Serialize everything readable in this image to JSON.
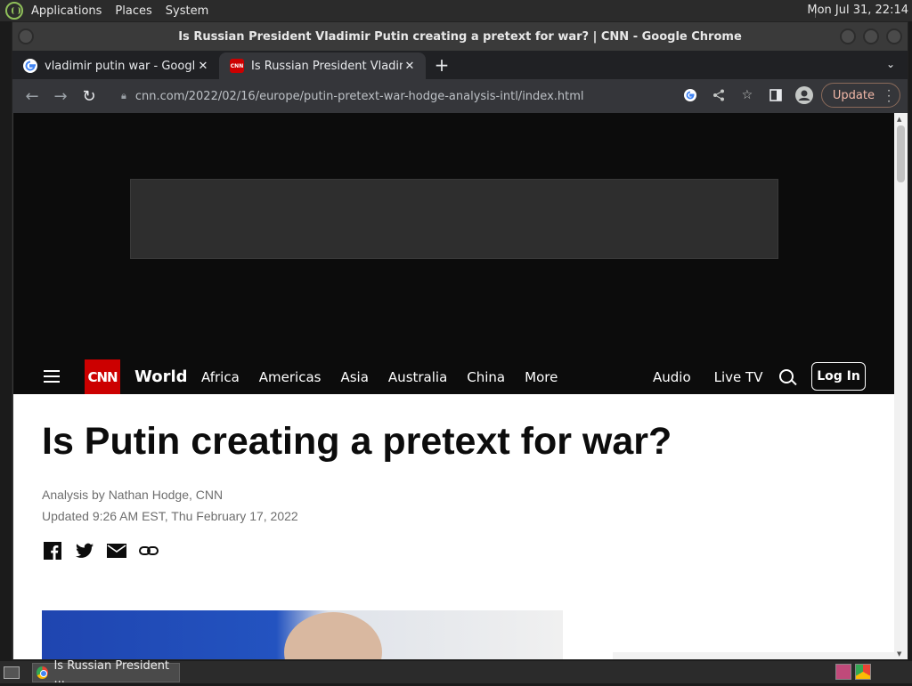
{
  "system_panel": {
    "menu": [
      "Applications",
      "Places",
      "System"
    ],
    "clock": "Mon Jul 31, 22:14"
  },
  "window": {
    "title": "Is Russian President Vladimir Putin creating a pretext for war? | CNN - Google Chrome"
  },
  "tabs": [
    {
      "title": "vladimir putin war - Google Se",
      "favicon": "google-icon",
      "active": false
    },
    {
      "title": "Is Russian President Vladimir P",
      "favicon": "cnn-icon",
      "active": true
    }
  ],
  "toolbar": {
    "url": "cnn.com/2022/02/16/europe/putin-pretext-war-hodge-analysis-intl/index.html",
    "update_label": "Update"
  },
  "cnn_nav": {
    "logo": "CNN",
    "section": "World",
    "links": [
      "Africa",
      "Americas",
      "Asia",
      "Australia",
      "China",
      "More"
    ],
    "right_links": [
      "Audio",
      "Live TV"
    ],
    "login": "Log In"
  },
  "article": {
    "headline": "Is Putin creating a pretext for war?",
    "byline": "Analysis by Nathan Hodge, CNN",
    "updated": "Updated 9:26 AM EST, Thu February 17, 2022",
    "share_icons": [
      "facebook-icon",
      "twitter-icon",
      "email-icon",
      "link-icon"
    ]
  },
  "taskbar": {
    "task_label": "Is Russian President ..."
  },
  "colors": {
    "cnn_red": "#cc0000",
    "chrome_dark": "#35363a",
    "tabstrip": "#202124"
  }
}
